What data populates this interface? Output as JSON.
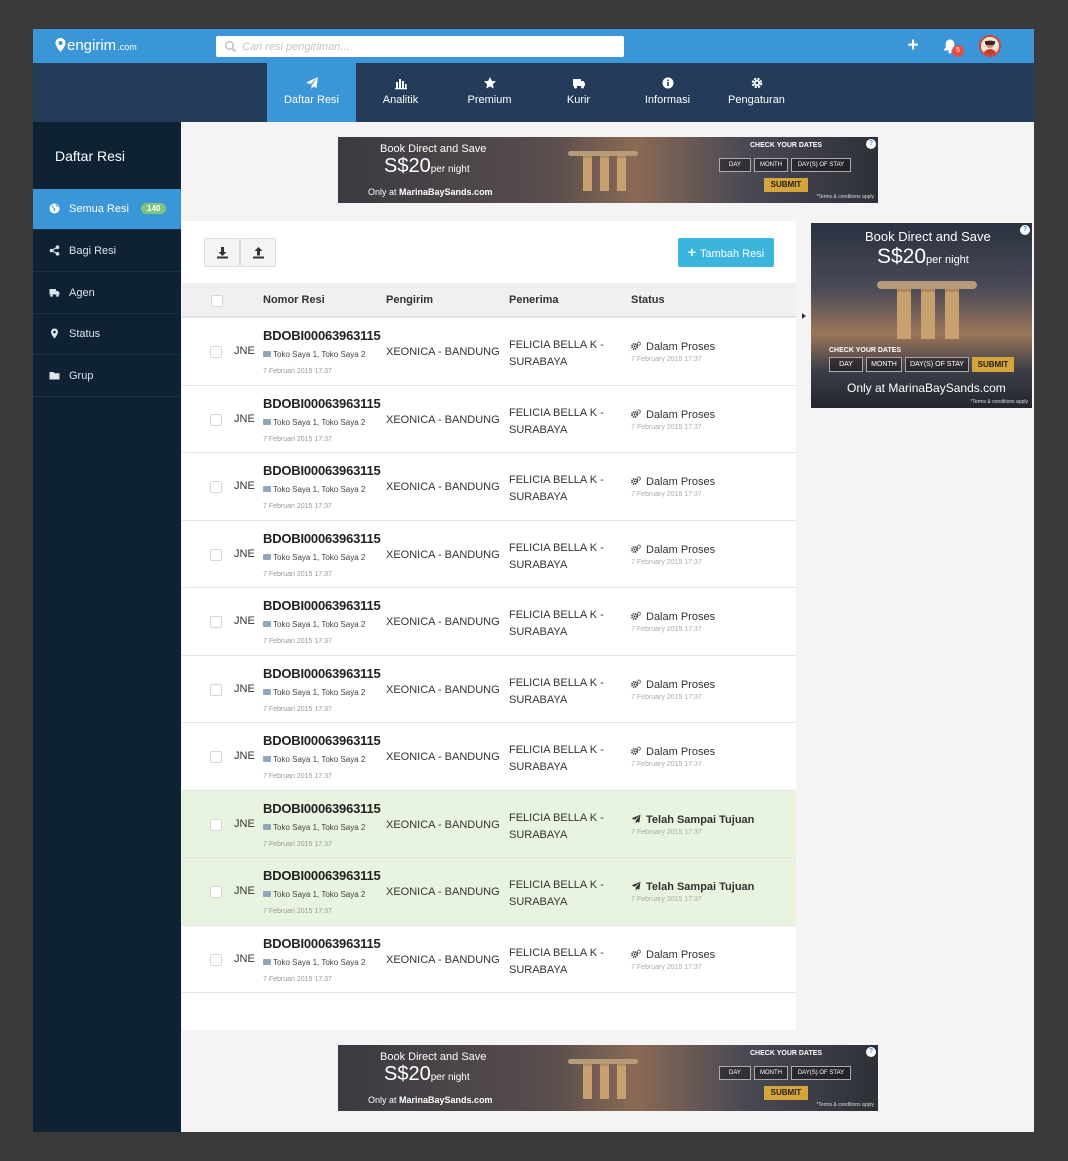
{
  "app": {
    "logo_text": "engirim",
    "logo_suffix": ".com"
  },
  "search": {
    "placeholder": "Cari resi pengiriman..."
  },
  "header": {
    "add_icon": "plus-icon",
    "notification_count": "5",
    "accent_color": "#3b96d8",
    "badge_color": "#e84c3d"
  },
  "nav": {
    "items": [
      {
        "label": "Daftar Resi",
        "icon": "send-icon",
        "active": true
      },
      {
        "label": "Analitik",
        "icon": "bar-chart-icon",
        "active": false
      },
      {
        "label": "Premium",
        "icon": "star-icon",
        "active": false
      },
      {
        "label": "Kurir",
        "icon": "truck-icon",
        "active": false
      },
      {
        "label": "Informasi",
        "icon": "info-icon",
        "active": false
      },
      {
        "label": "Pengaturan",
        "icon": "gear-icon",
        "active": false
      }
    ]
  },
  "sidebar": {
    "title": "Daftar Resi",
    "items": [
      {
        "label": "Semua Resi",
        "icon": "globe-icon",
        "count": "140",
        "active": true
      },
      {
        "label": "Bagi Resi",
        "icon": "share-icon",
        "active": false
      },
      {
        "label": "Agen",
        "icon": "truck-icon",
        "active": false
      },
      {
        "label": "Status",
        "icon": "map-marker-icon",
        "active": false
      },
      {
        "label": "Grup",
        "icon": "folder-icon",
        "active": false
      }
    ]
  },
  "ad_banner": {
    "line1": "Book Direct and Save",
    "price": "S$20",
    "per": "per night",
    "only_at": "Only at",
    "site": "MarinaBaySands.com",
    "check": "CHECK YOUR DATES",
    "day": "DAY",
    "month": "MONTH",
    "stay": "DAY(S) OF STAY",
    "submit": "SUBMIT",
    "terms": "*Terms & conditions apply",
    "info": "?"
  },
  "toolbar": {
    "download_icon": "download-icon",
    "upload_icon": "upload-icon",
    "add_label": "Tambah Resi"
  },
  "table": {
    "headers": {
      "resi": "Nomor Resi",
      "pengirim": "Pengirim",
      "penerima": "Penerima",
      "status": "Status"
    },
    "rows": [
      {
        "kurir": "JNE",
        "resi": "BDOBI00063963115",
        "toko": "Toko Saya 1, Toko Saya 2",
        "tanggal": "7 Februari 2015 17:37",
        "pengirim": "XEONICA - BANDUNG",
        "penerima_1": "FELICIA BELLA K -",
        "penerima_2": "SURABAYA",
        "status": "Dalam Proses",
        "status_date": "7 February 2015 17:37",
        "done": false
      },
      {
        "kurir": "JNE",
        "resi": "BDOBI00063963115",
        "toko": "Toko Saya 1, Toko Saya 2",
        "tanggal": "7 Februari 2015 17:37",
        "pengirim": "XEONICA - BANDUNG",
        "penerima_1": "FELICIA BELLA K -",
        "penerima_2": "SURABAYA",
        "status": "Dalam Proses",
        "status_date": "7 February 2015 17:37",
        "done": false
      },
      {
        "kurir": "JNE",
        "resi": "BDOBI00063963115",
        "toko": "Toko Saya 1, Toko Saya 2",
        "tanggal": "7 Februari 2015 17:37",
        "pengirim": "XEONICA - BANDUNG",
        "penerima_1": "FELICIA BELLA K -",
        "penerima_2": "SURABAYA",
        "status": "Dalam Proses",
        "status_date": "7 February 2015 17:37",
        "done": false
      },
      {
        "kurir": "JNE",
        "resi": "BDOBI00063963115",
        "toko": "Toko Saya 1, Toko Saya 2",
        "tanggal": "7 Februari 2015 17:37",
        "pengirim": "XEONICA - BANDUNG",
        "penerima_1": "FELICIA BELLA K -",
        "penerima_2": "SURABAYA",
        "status": "Dalam Proses",
        "status_date": "7 February 2015 17:37",
        "done": false
      },
      {
        "kurir": "JNE",
        "resi": "BDOBI00063963115",
        "toko": "Toko Saya 1, Toko Saya 2",
        "tanggal": "7 Februari 2015 17:37",
        "pengirim": "XEONICA - BANDUNG",
        "penerima_1": "FELICIA BELLA K -",
        "penerima_2": "SURABAYA",
        "status": "Dalam Proses",
        "status_date": "7 February 2015 17:37",
        "done": false
      },
      {
        "kurir": "JNE",
        "resi": "BDOBI00063963115",
        "toko": "Toko Saya 1, Toko Saya 2",
        "tanggal": "7 Februari 2015 17:37",
        "pengirim": "XEONICA - BANDUNG",
        "penerima_1": "FELICIA BELLA K -",
        "penerima_2": "SURABAYA",
        "status": "Dalam Proses",
        "status_date": "7 February 2015 17:37",
        "done": false
      },
      {
        "kurir": "JNE",
        "resi": "BDOBI00063963115",
        "toko": "Toko Saya 1, Toko Saya 2",
        "tanggal": "7 Februari 2015 17:37",
        "pengirim": "XEONICA - BANDUNG",
        "penerima_1": "FELICIA BELLA K -",
        "penerima_2": "SURABAYA",
        "status": "Dalam Proses",
        "status_date": "7 February 2015 17:37",
        "done": false
      },
      {
        "kurir": "JNE",
        "resi": "BDOBI00063963115",
        "toko": "Toko Saya 1, Toko Saya 2",
        "tanggal": "7 Februari 2015 17:37",
        "pengirim": "XEONICA - BANDUNG",
        "penerima_1": "FELICIA BELLA K -",
        "penerima_2": "SURABAYA",
        "status": "Telah Sampai Tujuan",
        "status_date": "7 February 2015 17:37",
        "done": true
      },
      {
        "kurir": "JNE",
        "resi": "BDOBI00063963115",
        "toko": "Toko Saya 1, Toko Saya 2",
        "tanggal": "7 Februari 2015 17:37",
        "pengirim": "XEONICA - BANDUNG",
        "penerima_1": "FELICIA BELLA K -",
        "penerima_2": "SURABAYA",
        "status": "Telah Sampai Tujuan",
        "status_date": "7 February 2015 17:37",
        "done": true
      },
      {
        "kurir": "JNE",
        "resi": "BDOBI00063963115",
        "toko": "Toko Saya 1, Toko Saya 2",
        "tanggal": "7 Februari 2015 17:37",
        "pengirim": "XEONICA - BANDUNG",
        "penerima_1": "FELICIA BELLA K -",
        "penerima_2": "SURABAYA",
        "status": "Dalam Proses",
        "status_date": "7 February 2015 17:37",
        "done": false
      }
    ]
  }
}
